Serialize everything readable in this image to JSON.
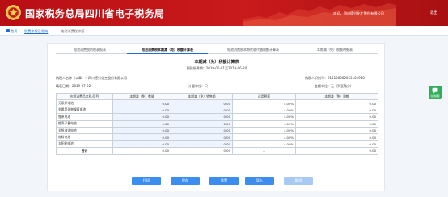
{
  "header": {
    "app_title": "国家税务总局四川省电子税务局",
    "welcome": "欢迎，四川德兴化工股份有限公司",
    "exit": "退出"
  },
  "breadcrumb": {
    "home": "首页",
    "tab1": "税费申报及缴纳",
    "tab2": "电池消费税申报"
  },
  "tabs": [
    {
      "label": "电池消费税的税表报表"
    },
    {
      "label": "电池消费税本期减（免）税额计算表"
    },
    {
      "label": "电池消费税本期代收代缴税额计算表"
    },
    {
      "label": "本期减（免）税额明细表"
    }
  ],
  "form": {
    "title": "本期减（免）税额计算表",
    "period": "税款所属期：2019-06-01至2019-06-30",
    "taxpayer": "纳税人名称（公章）：四川德兴化工股份有限公司",
    "tax_id": "纳税人识别号：915100002063101940",
    "fill_date": "填表日期：2019-07-22",
    "unit": "计量单位：只",
    "amount_unit": "金额单位：元（列至角分）"
  },
  "table": {
    "headers": [
      "应税消费品名称/项目",
      "本期减（免）数量",
      "本期减（免）销售额",
      "适用税率",
      "本期减（免）税额"
    ],
    "rows": [
      {
        "name": "无汞原电池",
        "qty": "0.00",
        "sales": "0.00",
        "rate": "4.00%",
        "tax": "0.00"
      },
      {
        "name": "金属氢化物镍蓄电池",
        "qty": "0.00",
        "sales": "0.00",
        "rate": "4.00%",
        "tax": "0.00"
      },
      {
        "name": "锂原电池",
        "qty": "0.00",
        "sales": "0.00",
        "rate": "4.00%",
        "tax": "0.00"
      },
      {
        "name": "锂离子蓄电池",
        "qty": "0.00",
        "sales": "0.00",
        "rate": "4.00%",
        "tax": "0.00"
      },
      {
        "name": "全钒液流电池",
        "qty": "0.00",
        "sales": "0.00",
        "rate": "4.00%",
        "tax": "0.00"
      },
      {
        "name": "燃料电池",
        "qty": "0.00",
        "sales": "0.00",
        "rate": "4.00%",
        "tax": "0.00"
      },
      {
        "name": "太阳能电池",
        "qty": "0.00",
        "sales": "0.00",
        "rate": "4.00%",
        "tax": "0.00"
      },
      {
        "name": "合计",
        "qty": "0.00",
        "sales": "0.00",
        "rate": "--",
        "tax": "0.00"
      }
    ]
  },
  "buttons": {
    "print": "打印",
    "save": "保存",
    "reset": "重置",
    "import": "导入",
    "cancel": "取消"
  },
  "float_service": {
    "label": "在线客服"
  },
  "colors": {
    "header_red": "#b80f14",
    "accent_blue": "#3b8ef0",
    "link_blue": "#1d6fd3",
    "float_green": "#2fae5b"
  }
}
